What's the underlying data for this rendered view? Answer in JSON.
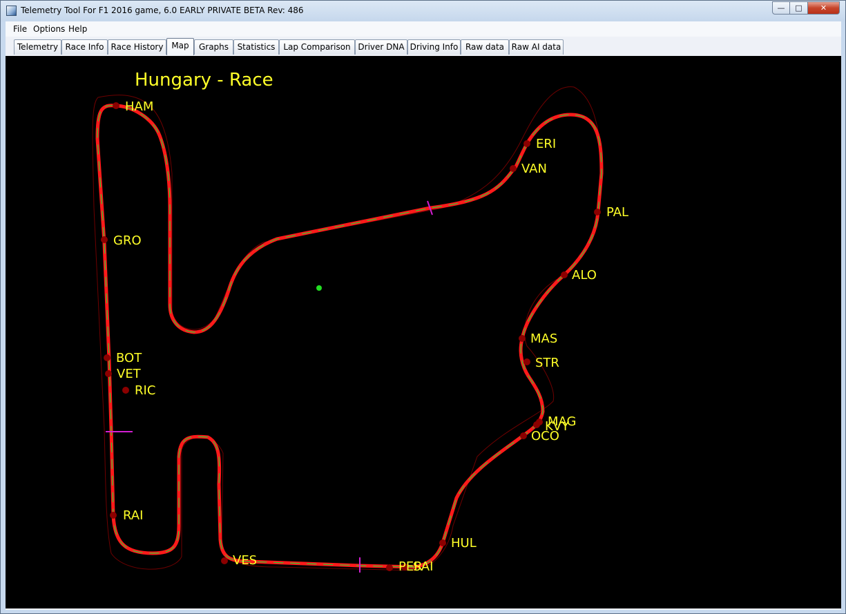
{
  "window": {
    "title": "Telemetry Tool For F1 2016 game, 6.0 EARLY PRIVATE BETA Rev: 486",
    "controls": {
      "minimize": "—",
      "maximize": "□",
      "close": "✕"
    }
  },
  "menu": [
    {
      "label": "File"
    },
    {
      "label": "Options"
    },
    {
      "label": "Help"
    }
  ],
  "tabs": [
    {
      "label": "Telemetry"
    },
    {
      "label": "Race Info"
    },
    {
      "label": "Race History"
    },
    {
      "label": "Map",
      "active": true
    },
    {
      "label": "Graphs"
    },
    {
      "label": "Statistics"
    },
    {
      "label": "Lap Comparison"
    },
    {
      "label": "Driver DNA"
    },
    {
      "label": "Driving Info"
    },
    {
      "label": "Raw data"
    },
    {
      "label": "Raw AI data"
    }
  ],
  "map": {
    "title": "Hungary - Race",
    "colors": {
      "background": "#000000",
      "track": "#ff1a1a",
      "racing_line": "#2ecc2e",
      "sector": "#d21ed2",
      "driver_dot": "#8b0000",
      "label": "#ffff28"
    },
    "drivers": [
      {
        "code": "HAM"
      },
      {
        "code": "ERI"
      },
      {
        "code": "VAN"
      },
      {
        "code": "PAL"
      },
      {
        "code": "GRO"
      },
      {
        "code": "ALO"
      },
      {
        "code": "MAS"
      },
      {
        "code": "STR"
      },
      {
        "code": "BOT"
      },
      {
        "code": "VET"
      },
      {
        "code": "RIC"
      },
      {
        "code": "MAG"
      },
      {
        "code": "KVY"
      },
      {
        "code": "OCO"
      },
      {
        "code": "RAI"
      },
      {
        "code": "HUL"
      },
      {
        "code": "VES"
      },
      {
        "code": "PER"
      },
      {
        "code": "SAI"
      }
    ]
  }
}
